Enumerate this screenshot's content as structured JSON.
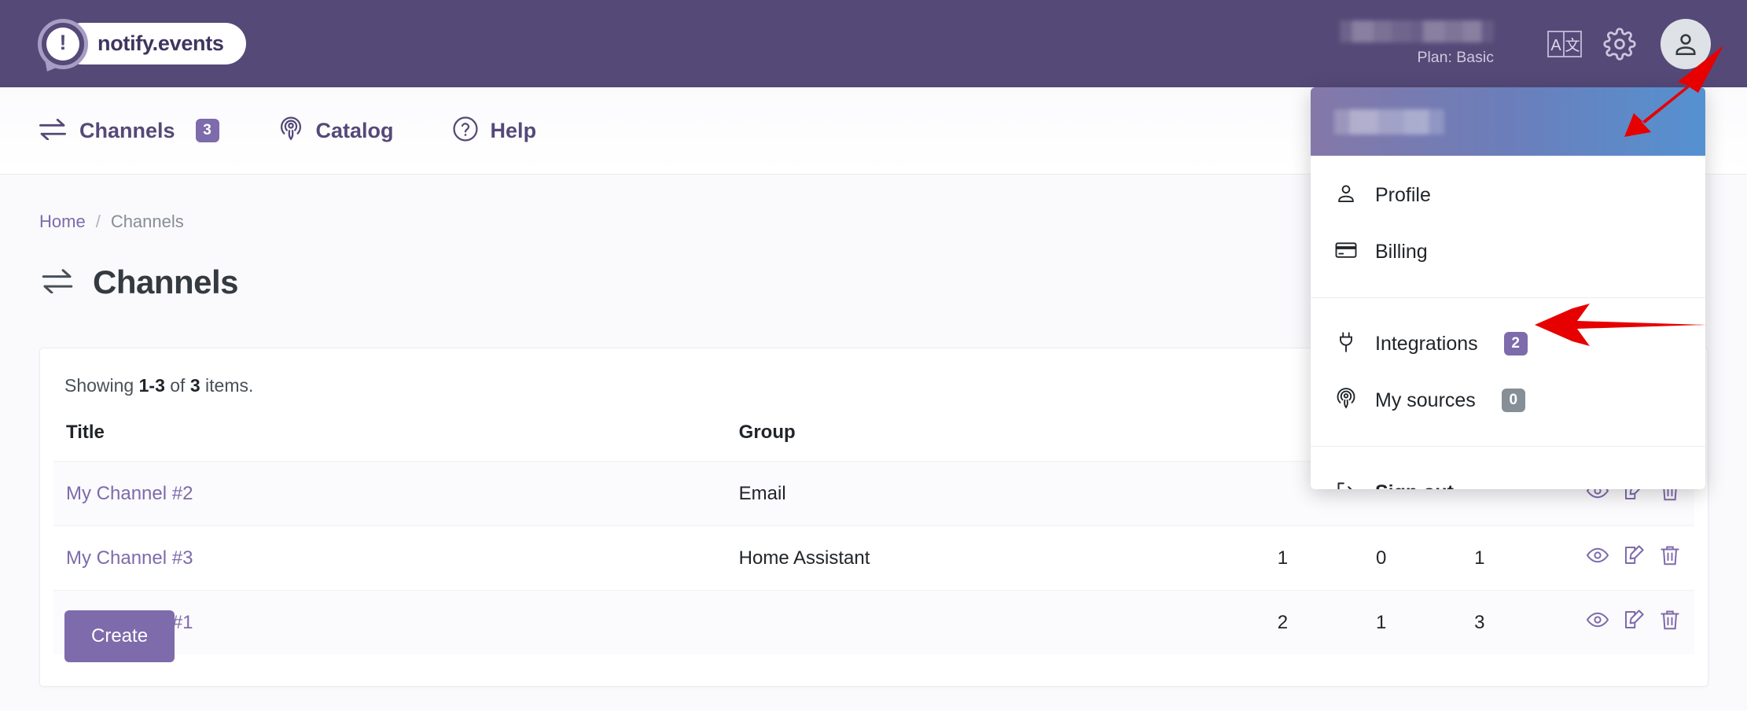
{
  "brand": {
    "name": "notify.events"
  },
  "header": {
    "username_blurred": "",
    "plan": "Plan: Basic",
    "translate_icon": "translate-icon",
    "settings_icon": "gear-icon",
    "avatar_icon": "user-avatar-icon"
  },
  "nav": {
    "items": [
      {
        "label": "Channels",
        "icon": "exchange-arrows-icon",
        "badge": "3"
      },
      {
        "label": "Catalog",
        "icon": "broadcast-icon",
        "badge": ""
      },
      {
        "label": "Help",
        "icon": "question-circle-icon",
        "badge": ""
      }
    ]
  },
  "breadcrumb": {
    "home": "Home",
    "separator": "/",
    "current": "Channels"
  },
  "page": {
    "title": "Channels",
    "title_icon": "exchange-arrows-icon"
  },
  "table_card": {
    "showing_prefix": "Showing",
    "showing_range": "1-3",
    "showing_of": "of",
    "showing_total": "3",
    "showing_suffix": "items.",
    "columns": [
      "Title",
      "Group",
      "",
      "",
      "",
      ""
    ],
    "rows": [
      {
        "title": "My Channel #2",
        "group": "Email",
        "c1": "",
        "c2": "",
        "c3": ""
      },
      {
        "title": "My Channel #3",
        "group": "Home Assistant",
        "c1": "1",
        "c2": "0",
        "c3": "1"
      },
      {
        "title": "My Channel #1",
        "group": "",
        "c1": "2",
        "c2": "1",
        "c3": "3"
      }
    ],
    "row_actions": [
      "view-icon",
      "edit-icon",
      "delete-icon"
    ],
    "create_label": "Create"
  },
  "dropdown": {
    "header_name_blurred": "",
    "items": [
      {
        "label": "Profile",
        "icon": "user-icon",
        "badge": "",
        "badge_style": ""
      },
      {
        "label": "Billing",
        "icon": "credit-card-icon",
        "badge": "",
        "badge_style": ""
      },
      {
        "label": "Integrations",
        "icon": "plug-icon",
        "badge": "2",
        "badge_style": "purple"
      },
      {
        "label": "My sources",
        "icon": "broadcast-icon",
        "badge": "0",
        "badge_style": "gray"
      },
      {
        "label": "Sign out",
        "icon": "logout-icon",
        "badge": "",
        "badge_style": ""
      }
    ]
  },
  "annotations": {
    "arrow_to_avatar": "red-arrow-pointing-to-avatar",
    "arrow_to_integrations": "red-arrow-pointing-to-integrations"
  },
  "colors": {
    "header_purple": "#554978",
    "accent_purple": "#7d6bab",
    "badge_gray": "#868e96",
    "page_bg": "#faf9fc",
    "annotation_red": "#e60000",
    "dd_gradient_start": "#8478a8",
    "dd_gradient_end": "#5591d1"
  }
}
